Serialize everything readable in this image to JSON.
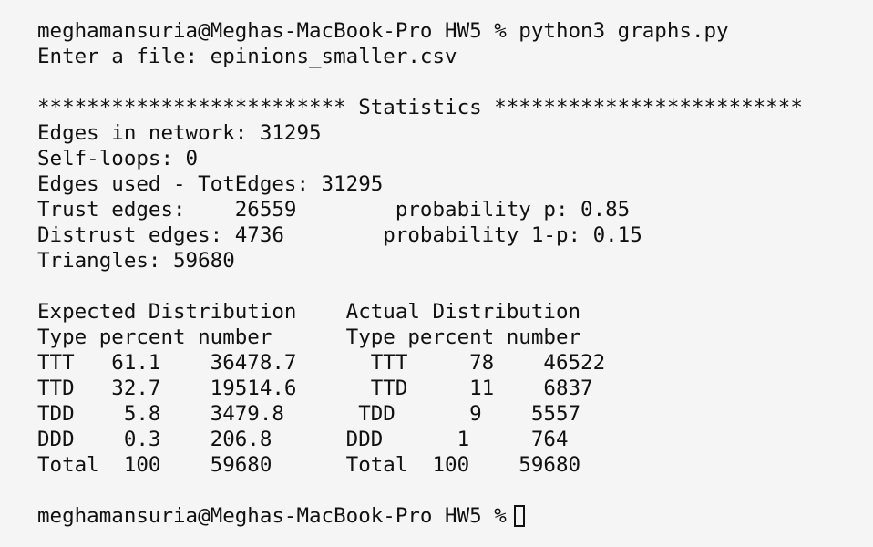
{
  "terminal": {
    "colors": {
      "background": "#f5f5f5",
      "text": "#111111"
    },
    "lines": [
      "meghamansuria@Meghas-MacBook-Pro HW5 % python3 graphs.py",
      "Enter a file: epinions_smaller.csv",
      "",
      "************************* Statistics *************************",
      "Edges in network: 31295",
      "Self-loops: 0",
      "Edges used - TotEdges: 31295",
      "Trust edges:    26559        probability p: 0.85",
      "Distrust edges: 4736        probability 1-p: 0.15",
      "Triangles: 59680",
      "",
      "Expected Distribution    Actual Distribution",
      "Type percent number      Type percent number",
      "TTT   61.1    36478.7      TTT     78    46522",
      "TTD   32.7    19514.6      TTD     11    6837",
      "TDD    5.8    3479.8      TDD      9    5557",
      "DDD    0.3    206.8      DDD      1     764",
      "Total  100    59680      Total  100    59680",
      ""
    ],
    "prompt": "meghamansuria@Meghas-MacBook-Pro HW5 %"
  }
}
